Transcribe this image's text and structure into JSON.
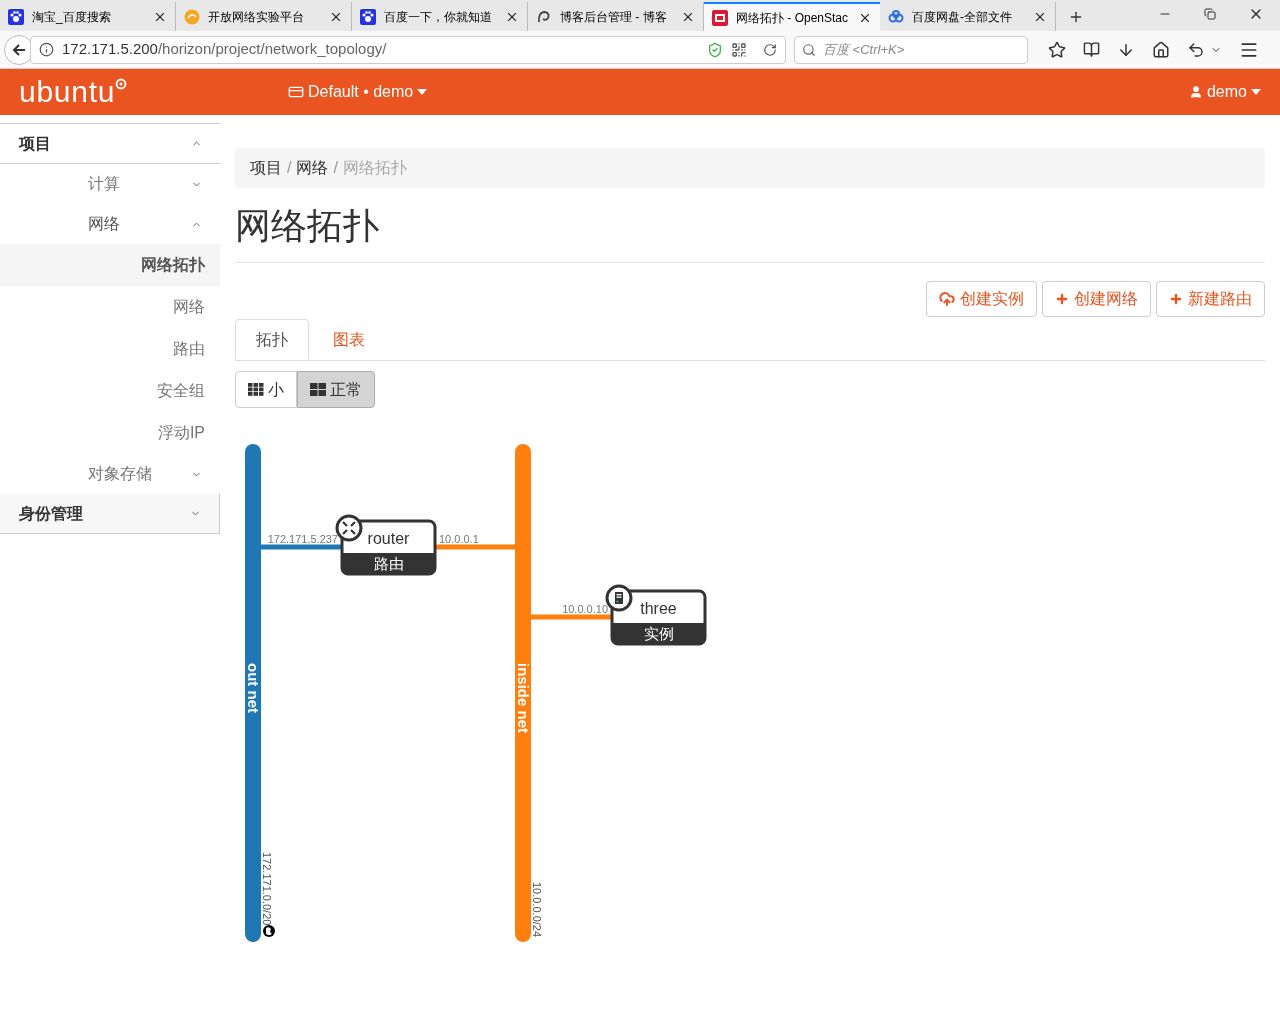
{
  "browser": {
    "tabs": [
      {
        "title": "淘宝_百度搜索",
        "kind": "paw",
        "selected": false
      },
      {
        "title": "开放网络实验平台",
        "kind": "orb",
        "selected": false
      },
      {
        "title": "百度一下，你就知道",
        "kind": "paw",
        "selected": false
      },
      {
        "title": "博客后台管理 - 博客",
        "kind": "swirl",
        "selected": false
      },
      {
        "title": "网络拓扑 - OpenStac",
        "kind": "stack",
        "selected": true
      },
      {
        "title": "百度网盘-全部文件",
        "kind": "cloud",
        "selected": false
      }
    ],
    "url_host": "172.171.5.200",
    "url_path": "/horizon/project/network_topology/",
    "search": {
      "placeholder": "百度 <Ctrl+K>"
    }
  },
  "header": {
    "logo": "ubuntu",
    "project": "Default • demo",
    "user": "demo"
  },
  "sidebar": {
    "items": [
      {
        "label": "项目",
        "expanded": true,
        "children": [
          {
            "label": "计算",
            "expanded": false
          },
          {
            "label": "网络",
            "expanded": true,
            "children": [
              {
                "label": "网络拓扑",
                "selected": true
              },
              {
                "label": "网络",
                "selected": false
              },
              {
                "label": "路由",
                "selected": false
              },
              {
                "label": "安全组",
                "selected": false
              },
              {
                "label": "浮动IP",
                "selected": false
              }
            ]
          },
          {
            "label": "对象存储",
            "expanded": false
          }
        ]
      },
      {
        "label": "身份管理",
        "expanded": false
      }
    ]
  },
  "breadcrumb": {
    "separator": "/",
    "items": [
      "项目",
      "网络",
      "网络拓扑"
    ]
  },
  "title": "网络拓扑",
  "actions": [
    {
      "label": "创建实例",
      "kind": "cloud-upload"
    },
    {
      "label": "创建网络",
      "kind": "plus"
    },
    {
      "label": "新建路由",
      "kind": "plus"
    }
  ],
  "tabs": [
    {
      "label": "拓扑",
      "selected": true
    },
    {
      "label": "图表",
      "selected": false
    }
  ],
  "view_toggle": [
    {
      "label": "小",
      "kind": "grid-small",
      "selected": false
    },
    {
      "label": "正常",
      "kind": "grid-large",
      "selected": true
    }
  ],
  "topology": {
    "networks": [
      {
        "name": "out net",
        "cidr": "172.171.0.0/20",
        "color": "#1f77b4",
        "external": true
      },
      {
        "name": "inside net",
        "cidr": "10.0.0.0/24",
        "color": "#ff7f0e"
      }
    ],
    "devices": [
      {
        "name": "router",
        "type": "路由",
        "kind": "router",
        "ports": [
          {
            "ip": "172.171.5.237"
          },
          {
            "ip": "10.0.0.1"
          }
        ]
      },
      {
        "name": "three",
        "type": "实例",
        "kind": "instance",
        "ports": [
          {
            "ip": "10.0.0.10"
          }
        ]
      }
    ]
  }
}
